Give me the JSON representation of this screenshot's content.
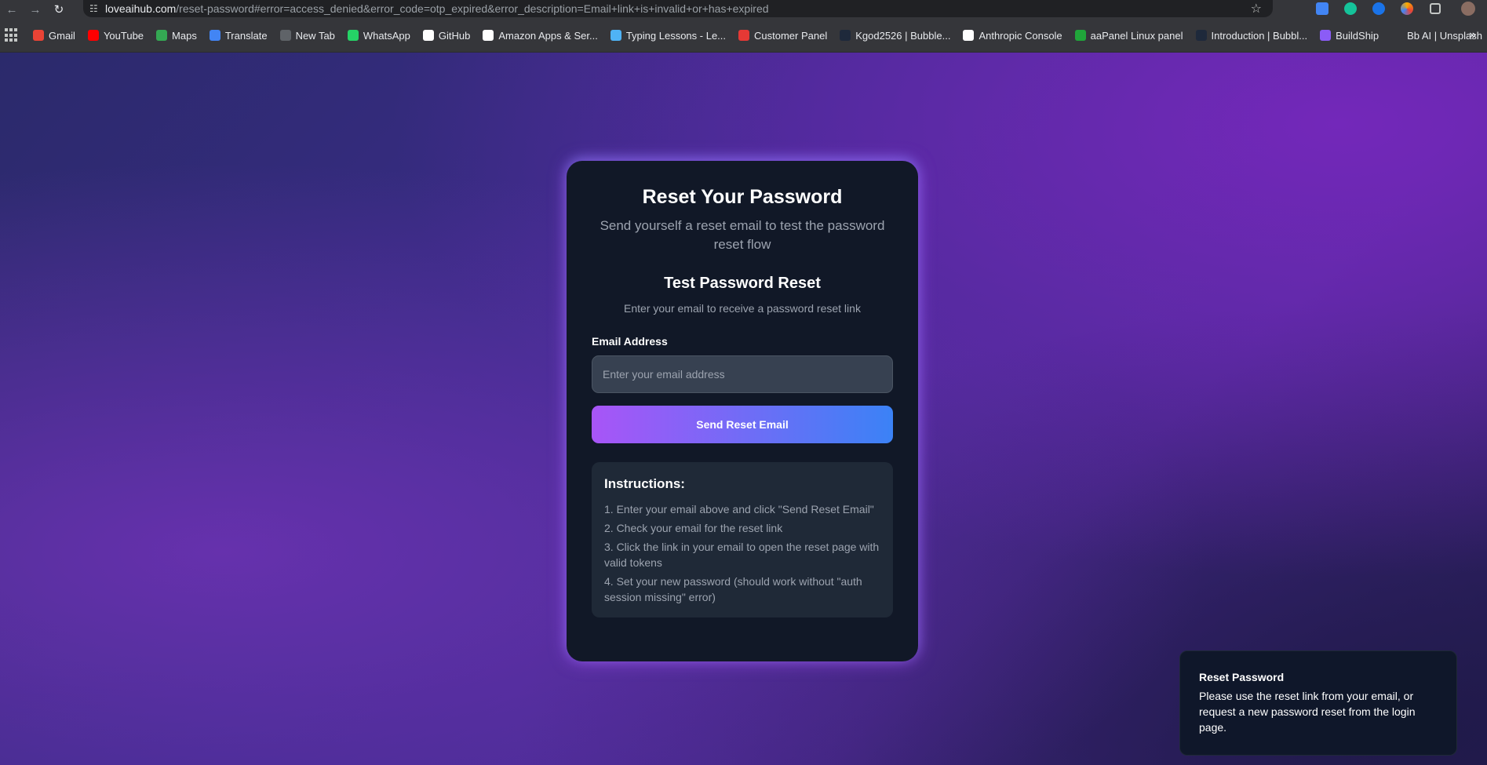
{
  "browser": {
    "url_domain": "loveaihub.com",
    "url_path": "/reset-password#error=access_denied&error_code=otp_expired&error_description=Email+link+is+invalid+or+has+expired",
    "bookmarks": [
      {
        "label": "Gmail",
        "icon": "gmail-icon",
        "color": "#ea4335"
      },
      {
        "label": "YouTube",
        "icon": "youtube-icon",
        "color": "#ff0000"
      },
      {
        "label": "Maps",
        "icon": "maps-icon",
        "color": "#34a853"
      },
      {
        "label": "Translate",
        "icon": "translate-icon",
        "color": "#4285f4"
      },
      {
        "label": "New Tab",
        "icon": "globe-icon",
        "color": "#5f6368"
      },
      {
        "label": "WhatsApp",
        "icon": "whatsapp-icon",
        "color": "#25d366"
      },
      {
        "label": "GitHub",
        "icon": "github-icon",
        "color": "#ffffff"
      },
      {
        "label": "Amazon Apps & Ser...",
        "icon": "amazon-icon",
        "color": "#ffffff"
      },
      {
        "label": "Typing Lessons - Le...",
        "icon": "typing-icon",
        "color": "#4fb3f6"
      },
      {
        "label": "Customer Panel",
        "icon": "g-icon",
        "color": "#e53935"
      },
      {
        "label": "Kgod2526 | Bubble...",
        "icon": "bubble-icon",
        "color": "#1e293b"
      },
      {
        "label": "Anthropic Console",
        "icon": "anthropic-icon",
        "color": "#ffffff"
      },
      {
        "label": "aaPanel Linux panel",
        "icon": "aapanel-icon",
        "color": "#20a53a"
      },
      {
        "label": "Introduction | Bubbl...",
        "icon": "bubble-icon",
        "color": "#1e293b"
      },
      {
        "label": "BuildShip",
        "icon": "buildship-icon",
        "color": "#8b5cf6"
      },
      {
        "label": "Bb AI | Unsplash",
        "icon": "unsplash-icon",
        "color": "#35363a"
      }
    ]
  },
  "card": {
    "title": "Reset Your Password",
    "subtitle": "Send yourself a reset email to test the password reset flow",
    "section_title": "Test Password Reset",
    "section_subtitle": "Enter your email to receive a password reset link",
    "email_label": "Email Address",
    "email_placeholder": "Enter your email address",
    "submit_label": "Send Reset Email",
    "instructions_title": "Instructions:",
    "instructions": [
      "1. Enter your email above and click \"Send Reset Email\"",
      "2. Check your email for the reset link",
      "3. Click the link in your email to open the reset page with valid tokens",
      "4. Set your new password (should work without \"auth session missing\" error)"
    ]
  },
  "toast": {
    "title": "Reset Password",
    "message": "Please use the reset link from your email, or request a new password reset from the login page."
  },
  "colors": {
    "accent_start": "#a855f7",
    "accent_end": "#3b82f6",
    "card_bg": "#111827"
  }
}
